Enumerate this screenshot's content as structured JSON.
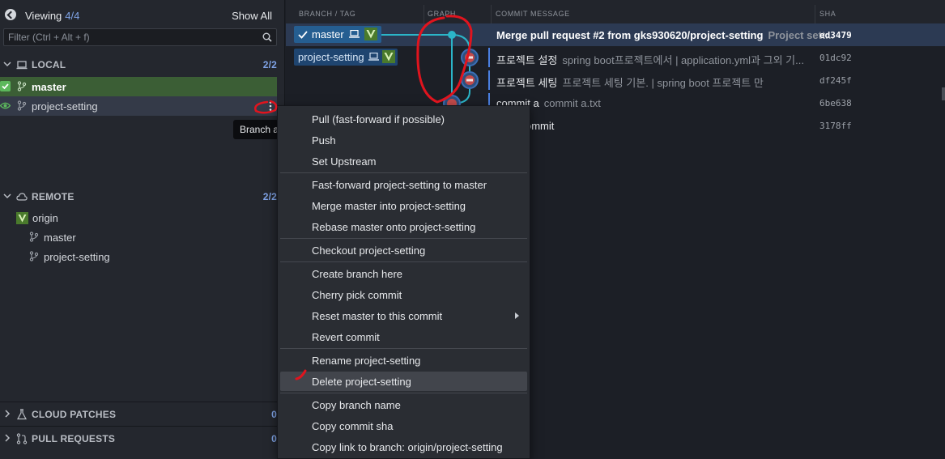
{
  "left_panel": {
    "viewing_label": "Viewing",
    "viewing_count": "4/4",
    "show_all": "Show All",
    "filter_placeholder": "Filter (Ctrl + Alt + f)",
    "local": {
      "label": "LOCAL",
      "count": "2/2",
      "branches": [
        "master",
        "project-setting"
      ]
    },
    "tooltip": "Branch a",
    "remote": {
      "label": "REMOTE",
      "count": "2/2",
      "origin": "origin",
      "branches": [
        "master",
        "project-setting"
      ]
    },
    "cloud_patches": {
      "label": "CLOUD PATCHES",
      "count": "0"
    },
    "pull_requests": {
      "label": "PULL REQUESTS",
      "count": "0"
    }
  },
  "graph": {
    "columns": [
      "BRANCH / TAG",
      "GRAPH",
      "COMMIT MESSAGE",
      "SHA"
    ],
    "branch_badges": [
      "master",
      "project-setting"
    ],
    "commits": [
      {
        "title": "Merge pull request #2 from gks930620/project-setting",
        "desc": "Project sett...",
        "sha": "ed3479"
      },
      {
        "title": "프로젝트 설정",
        "desc": "spring boot프로젝트에서 | application.yml과 그외 기...",
        "sha": "01dc92"
      },
      {
        "title": "프로젝트 세팅",
        "desc": "프로젝트 세팅 기본. | spring boot 프로젝트 만",
        "sha": "df245f"
      },
      {
        "title": "commit a",
        "desc": "commit a.txt",
        "sha": "6be638"
      },
      {
        "title": "ommit",
        "desc": "",
        "sha": "3178ff"
      }
    ]
  },
  "context_menu": {
    "items": [
      "Pull (fast-forward if possible)",
      "Push",
      "Set Upstream",
      "Fast-forward project-setting to master",
      "Merge master into project-setting",
      "Rebase master onto project-setting",
      "Checkout project-setting",
      "Create branch here",
      "Cherry pick commit",
      "Reset master to this commit",
      "Revert commit",
      "Rename project-setting",
      "Delete project-setting",
      "Copy branch name",
      "Copy commit sha",
      "Copy link to branch: origin/project-setting"
    ]
  },
  "colors": {
    "accent": "#4a7fe0",
    "master_row": "#3b5e35",
    "graph_line": "#2bb5c8",
    "annotation": "#e0141e"
  }
}
